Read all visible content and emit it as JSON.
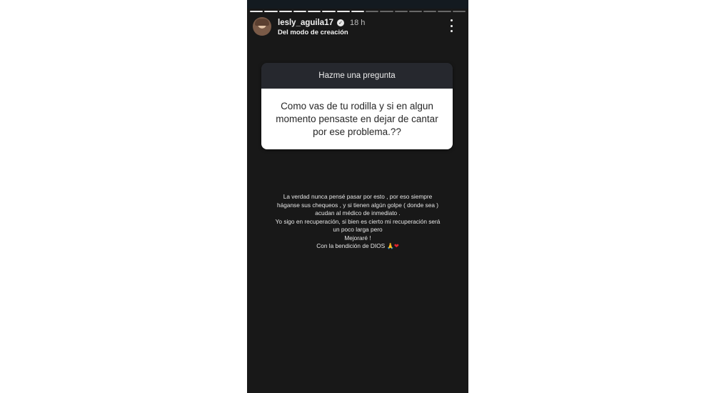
{
  "story": {
    "progress": {
      "total_segments": 15,
      "completed_segments": 8
    },
    "author": {
      "username": "lesly_aguila17",
      "verified": true,
      "time_ago": "18 h",
      "subtitle": "Del modo de creación"
    },
    "question_sticker": {
      "title": "Hazme una pregunta",
      "question": "Como vas de tu rodilla y si en algun momento pensaste en dejar de cantar por ese problema.??"
    },
    "answer_lines": [
      "La verdad nunca pensé pasar por esto , por eso siempre",
      "háganse sus chequeos , y si tienen algún golpe ( donde sea )",
      "acudan al médico de inmediato .",
      "Yo sigo en recuperación, si bien es cierto mi recuperación será",
      "un poco larga pero",
      "Mejoraré !",
      "Con la bendición de DIOS"
    ],
    "emoji": {
      "praying_hands": "🙏",
      "heart": "❤"
    }
  },
  "colors": {
    "story_background": "#181818",
    "sticker_header": "#26282e",
    "sticker_body": "#ffffff",
    "heart": "#e0242f"
  },
  "icons": {
    "verified": "verified-badge-icon",
    "more": "more-options-icon"
  }
}
